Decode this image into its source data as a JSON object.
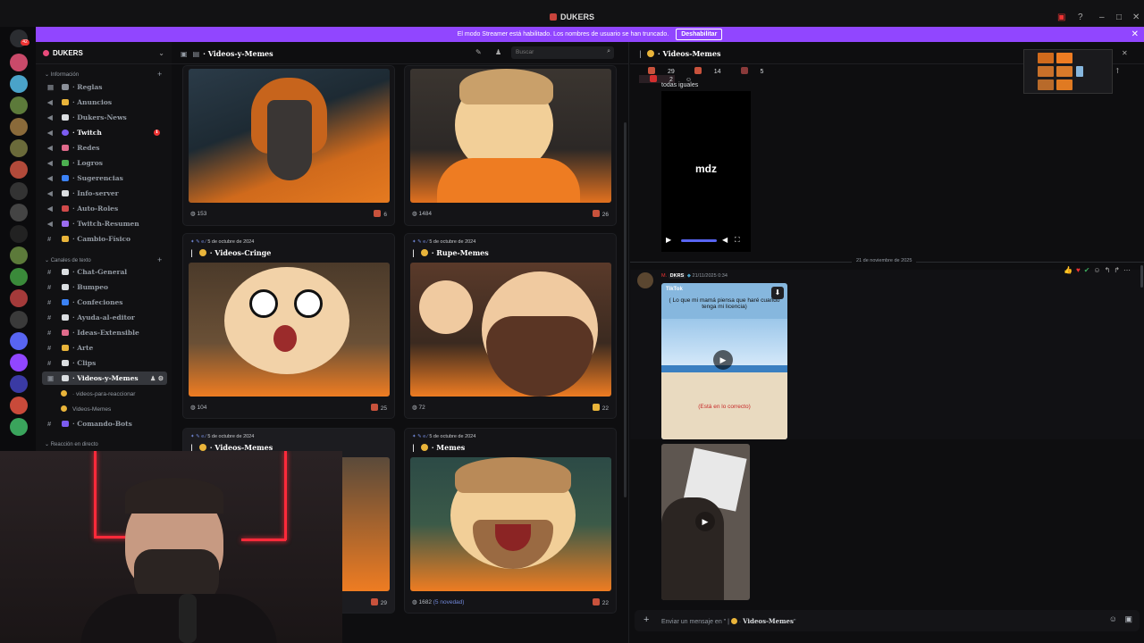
{
  "window": {
    "title": "DUKERS"
  },
  "banner": {
    "text": "El modo Streamer está habilitado. Los nombres de usuario se han truncado.",
    "button": "Deshabilitar"
  },
  "guild_badges": [
    "42"
  ],
  "server": {
    "name": "DUKERS"
  },
  "categories": {
    "info": "Información",
    "text": "Canales de texto",
    "live": "Reacción en directo"
  },
  "channels": [
    {
      "label": "Reglas",
      "color": "#8a8f98"
    },
    {
      "label": "Anuncios",
      "color": "#e9b43a"
    },
    {
      "label": "Dukers-News",
      "color": "#dbdee1"
    },
    {
      "label": "Twitch",
      "color": "#7c5cf0",
      "badge": "1"
    },
    {
      "label": "Redes",
      "color": "#e06b8b"
    },
    {
      "label": "Logros",
      "color": "#4caf50"
    },
    {
      "label": "Sugerencias",
      "color": "#3b82f6"
    },
    {
      "label": "Info-server",
      "color": "#dbdee1"
    },
    {
      "label": "Auto-Roles",
      "color": "#d04a4a"
    },
    {
      "label": "Twitch-Resumen",
      "color": "#9b6cf0"
    },
    {
      "label": "Cambio-Físico",
      "color": "#e9b43a"
    },
    {
      "label": "Chat-General",
      "color": "#dbdee1"
    },
    {
      "label": "Bumpeo",
      "color": "#dbdee1"
    },
    {
      "label": "Confeciones",
      "color": "#3b82f6"
    },
    {
      "label": "Ayuda-al-editor",
      "color": "#dbdee1"
    },
    {
      "label": "Ideas-Extensible",
      "color": "#e06b8b"
    },
    {
      "label": "Arte",
      "color": "#e9b43a"
    },
    {
      "label": "Clips",
      "color": "#dbdee1"
    },
    {
      "label": "Videos-y-Memes",
      "color": "#dbdee1"
    },
    {
      "label": "Comando-Bots",
      "color": "#7c5cf0"
    }
  ],
  "threads": [
    "videos-para-reaccionar",
    "Videos-Memes"
  ],
  "forum": {
    "title": "Videos-y-Memes",
    "search_placeholder": "Buscar",
    "posts": [
      {
        "comments": "153",
        "reactions": "6"
      },
      {
        "comments": "1484",
        "reactions": "26"
      },
      {
        "date": "5 de octubre de 2024",
        "title": "Videos-Cringe",
        "comments": "104",
        "reactions": "25"
      },
      {
        "date": "5 de octubre de 2024",
        "title": "Rupe-Memes",
        "comments": "72",
        "reactions": "22"
      },
      {
        "date": "5 de octubre de 2024",
        "title": "Videos-Memes",
        "comments": "",
        "reactions": "29"
      },
      {
        "date": "5 de octubre de 2024",
        "title": "Memes",
        "comments": "1682",
        "new": "(5 novedad)",
        "reactions": "22"
      }
    ]
  },
  "chat": {
    "title": "Videos-Memes",
    "top_reactions": [
      "29",
      "14",
      "5",
      "2"
    ],
    "first_text": "todas iguales",
    "video_brand": "mdz",
    "date_divider": "21 de noviembre de 2025",
    "msg_tag": "DKRS",
    "msg_time": "21/11/2025 0:34",
    "tiktok_label": "TikTok",
    "tiktok_caption": "( Lo que mi mamá piensa que haré cuando tenga mi licencia)",
    "tiktok_caption2": "(Está en lo correcto)",
    "composer_placeholder": "Enviar un mensaje en",
    "composer_channel": "Videos-Memes"
  }
}
